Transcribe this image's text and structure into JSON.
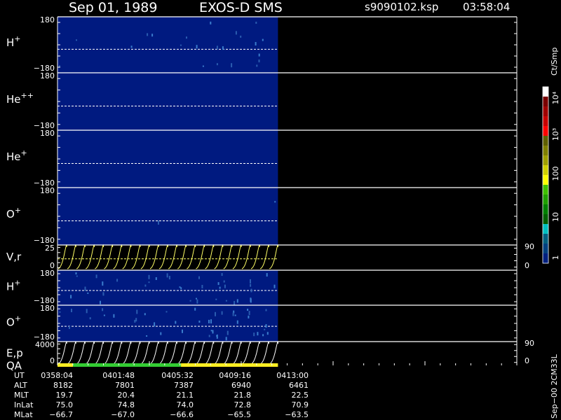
{
  "header": {
    "date": "Sep 01, 1989",
    "instrument": "EXOS-D SMS",
    "file": "s9090102.ksp",
    "time": "03:58:04"
  },
  "colors": {
    "background": "#000000",
    "panel_fill": "#001a80",
    "trace": "#ffff66",
    "trace_white": "#ffffff",
    "dash": "#ffffff",
    "qa_yellow": "#ffee22",
    "qa_green": "#33cc33"
  },
  "chart_data": {
    "type": "heatmap",
    "data_end_fraction": 0.48,
    "panels": [
      {
        "id": "h1",
        "label": "H",
        "sup": "+",
        "ytop": "180",
        "ybot": "−180",
        "kind": "spec",
        "speckles": 22
      },
      {
        "id": "he2",
        "label": "He",
        "sup": "++",
        "ytop": "180",
        "ybot": "−180",
        "kind": "spec",
        "speckles": 0
      },
      {
        "id": "he1",
        "label": "He",
        "sup": "+",
        "ytop": "180",
        "ybot": "−180",
        "kind": "spec",
        "speckles": 0
      },
      {
        "id": "o1",
        "label": "O",
        "sup": "+",
        "ytop": "180",
        "ybot": "−180",
        "kind": "spec",
        "speckles": 2
      },
      {
        "id": "vr",
        "label": "V,r",
        "sup": "",
        "ytop": "25",
        "ybot": "0",
        "kind": "trace",
        "trace_color": "#ffff66",
        "rtop": "90",
        "rbot": "0",
        "cycles": 24
      },
      {
        "id": "h2",
        "label": "H",
        "sup": "+",
        "ytop": "180",
        "ybot": "−180",
        "kind": "spec",
        "speckles": 40
      },
      {
        "id": "o2",
        "label": "O",
        "sup": "+",
        "ytop": "180",
        "ybot": "−180",
        "kind": "spec",
        "speckles": 45
      },
      {
        "id": "ep",
        "label": "E,p",
        "sup": "",
        "label2": "QA",
        "ytop": "4000",
        "ybot": "0",
        "kind": "trace",
        "trace_color": "#ffffff",
        "rtop": "90",
        "rbot": "0",
        "cycles": 24
      }
    ],
    "qa_segments": [
      {
        "from": 0.0,
        "to": 0.07,
        "color": "#ffee22"
      },
      {
        "from": 0.07,
        "to": 0.56,
        "color": "#33cc33"
      },
      {
        "from": 0.56,
        "to": 1.0,
        "color": "#ffee22"
      }
    ],
    "colorbar": {
      "unit": "Ct/Smp",
      "labels": [
        "10⁴",
        "10³",
        "100",
        "10",
        "1"
      ],
      "colors": [
        "#ffffff",
        "#7a0000",
        "#a00000",
        "#c80000",
        "#ff0000",
        "#606000",
        "#808000",
        "#a0a000",
        "#d0d000",
        "#ffff00",
        "#40c000",
        "#20a000",
        "#008000",
        "#006000",
        "#00c0c0",
        "#006080",
        "#004080",
        "#002080"
      ]
    },
    "footer": {
      "row_labels": [
        "UT",
        "ALT",
        "MLT",
        "InLat",
        "MLat"
      ],
      "columns": [
        [
          "0358:04",
          "8182",
          "19.7",
          "75.0",
          "−66.7"
        ],
        [
          "0401:48",
          "7801",
          "20.4",
          "74.8",
          "−67.0"
        ],
        [
          "0405:32",
          "7387",
          "21.1",
          "74.0",
          "−66.6"
        ],
        [
          "0409:16",
          "6940",
          "21.8",
          "72.8",
          "−65.5"
        ],
        [
          "0413:00",
          "6461",
          "22.5",
          "70.9",
          "−63.5"
        ]
      ]
    },
    "side_text": "Sep−00  2CM33L"
  }
}
